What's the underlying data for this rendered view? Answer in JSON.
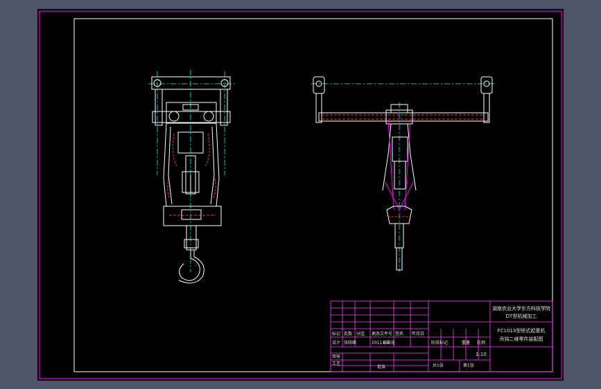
{
  "title_block": {
    "institution_line1": "湖南农业大学东方科技学院",
    "institution_line2": "DT型机械加工",
    "drawing_name_line1": "FC1013型桥式起重机",
    "drawing_name_line2": "吊钩二维零件装配图",
    "scale_value": "1:10",
    "headers": {
      "mark": "标记",
      "count": "处数",
      "zone": "分区",
      "change_doc": "更改文件号",
      "signature": "签名",
      "date": "年月日",
      "design": "设计",
      "designer": "张晓峰",
      "design_date": "2011.05",
      "standardize": "标准化",
      "stage_mark": "阶段标记",
      "weight": "重量",
      "scale": "比例",
      "review": "审核",
      "process": "工艺",
      "approve": "批准",
      "sheets_total": "共1张",
      "sheet_no": "第1张"
    }
  },
  "colors": {
    "background": "#000000",
    "frame": "#c000c0",
    "lines": "#ffffff",
    "center_lines": "#00c8c8",
    "hidden_lines": "#ff3030",
    "magenta_lines": "#ff00ff"
  }
}
